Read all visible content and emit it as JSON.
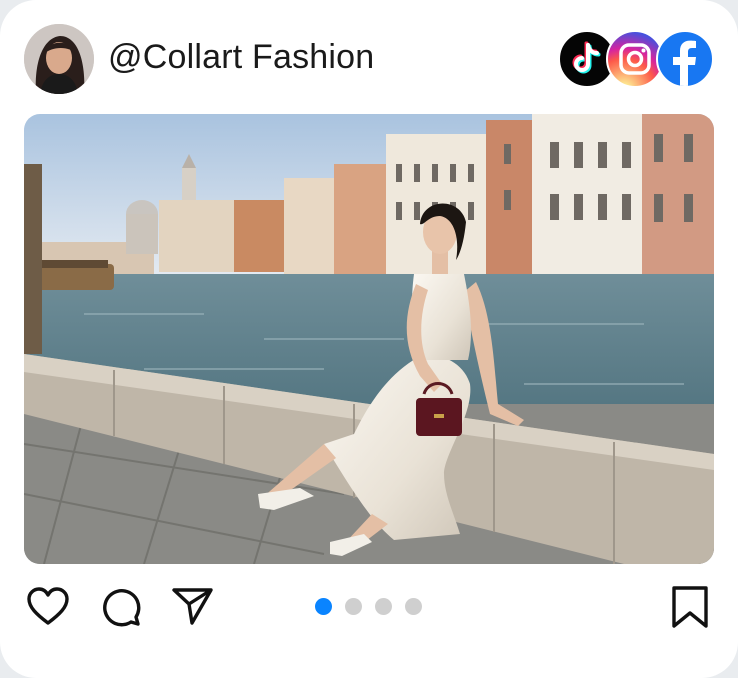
{
  "post": {
    "username": "@Collart Fashion"
  },
  "header": {
    "social_icons": [
      "tiktok-icon",
      "instagram-icon",
      "facebook-icon"
    ]
  },
  "carousel": {
    "total": 4,
    "active_index": 0,
    "active_color": "#0a84ff",
    "inactive_color": "#cfcfcf"
  },
  "actions": [
    "heart-icon",
    "comment-icon",
    "share-icon",
    "bookmark-icon"
  ],
  "colors": {
    "tiktok": "#050505",
    "facebook": "#1877f2",
    "text": "#1a1a1a"
  }
}
